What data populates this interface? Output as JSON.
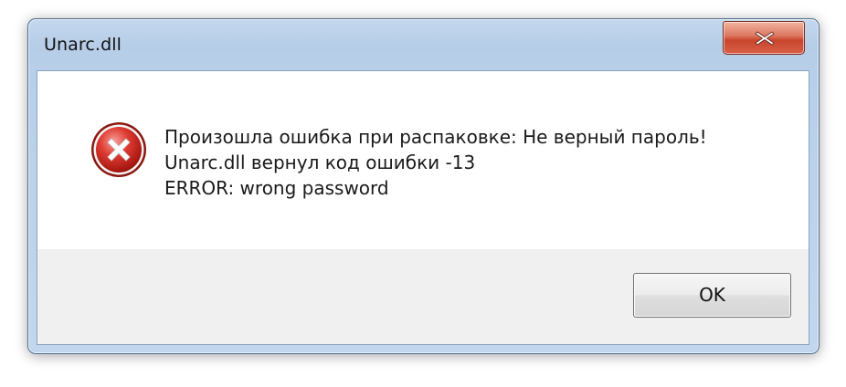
{
  "window": {
    "title": "Unarc.dll",
    "close_icon": "close-icon"
  },
  "message": {
    "icon": "error-icon",
    "lines": [
      "Произошла ошибка при распаковке: Не верный пароль!",
      "Unarc.dll вернул код ошибки -13",
      "ERROR: wrong password"
    ]
  },
  "buttons": {
    "ok_label": "OK"
  },
  "colors": {
    "error_red": "#c8231a",
    "close_button_red": "#c9452c",
    "frame_blue": "#b8cfe9"
  }
}
